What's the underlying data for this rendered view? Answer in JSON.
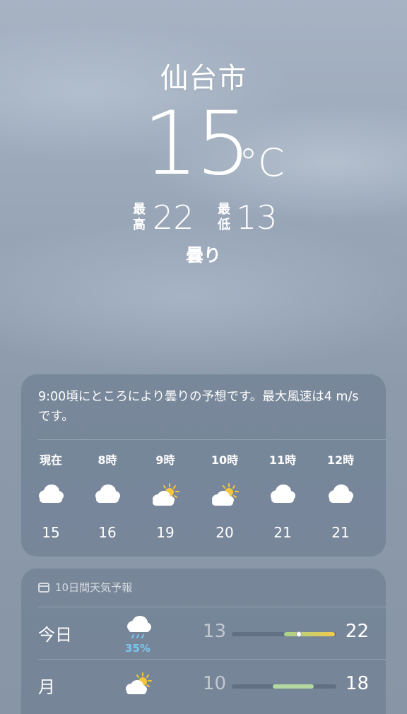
{
  "location": {
    "city": "仙台市"
  },
  "current": {
    "temperature": "15",
    "unit": "°C",
    "high_label_top": "最",
    "high_label_bottom": "高",
    "high": "22",
    "low_label_top": "最",
    "low_label_bottom": "低",
    "low": "13",
    "condition": "曇り"
  },
  "hourly": {
    "summary": "9:00頃にところにより曇りの予想です。最大風速は4 m/sです。",
    "items": [
      {
        "time": "現在",
        "icon": "cloud-icon",
        "temp": "15"
      },
      {
        "time": "8時",
        "icon": "cloud-icon",
        "temp": "16"
      },
      {
        "time": "9時",
        "icon": "partly-sunny-icon",
        "temp": "19"
      },
      {
        "time": "10時",
        "icon": "partly-sunny-icon",
        "temp": "20"
      },
      {
        "time": "11時",
        "icon": "cloud-icon",
        "temp": "21"
      },
      {
        "time": "12時",
        "icon": "cloud-icon",
        "temp": "21"
      }
    ]
  },
  "daily": {
    "title": "10日間天気予報",
    "days": [
      {
        "day": "今日",
        "icon": "rain-cloud-icon",
        "precip": "35%",
        "low": "13",
        "high": "22"
      },
      {
        "day": "月",
        "icon": "partly-sunny-icon",
        "precip": "",
        "low": "10",
        "high": "18"
      }
    ]
  },
  "colors": {
    "precip": "#79c8f3",
    "bar_today_start": "#a8d38a",
    "bar_today_end": "#f2c94c",
    "bar_monday": "#b3d9a0",
    "sun": "#f5c542"
  }
}
